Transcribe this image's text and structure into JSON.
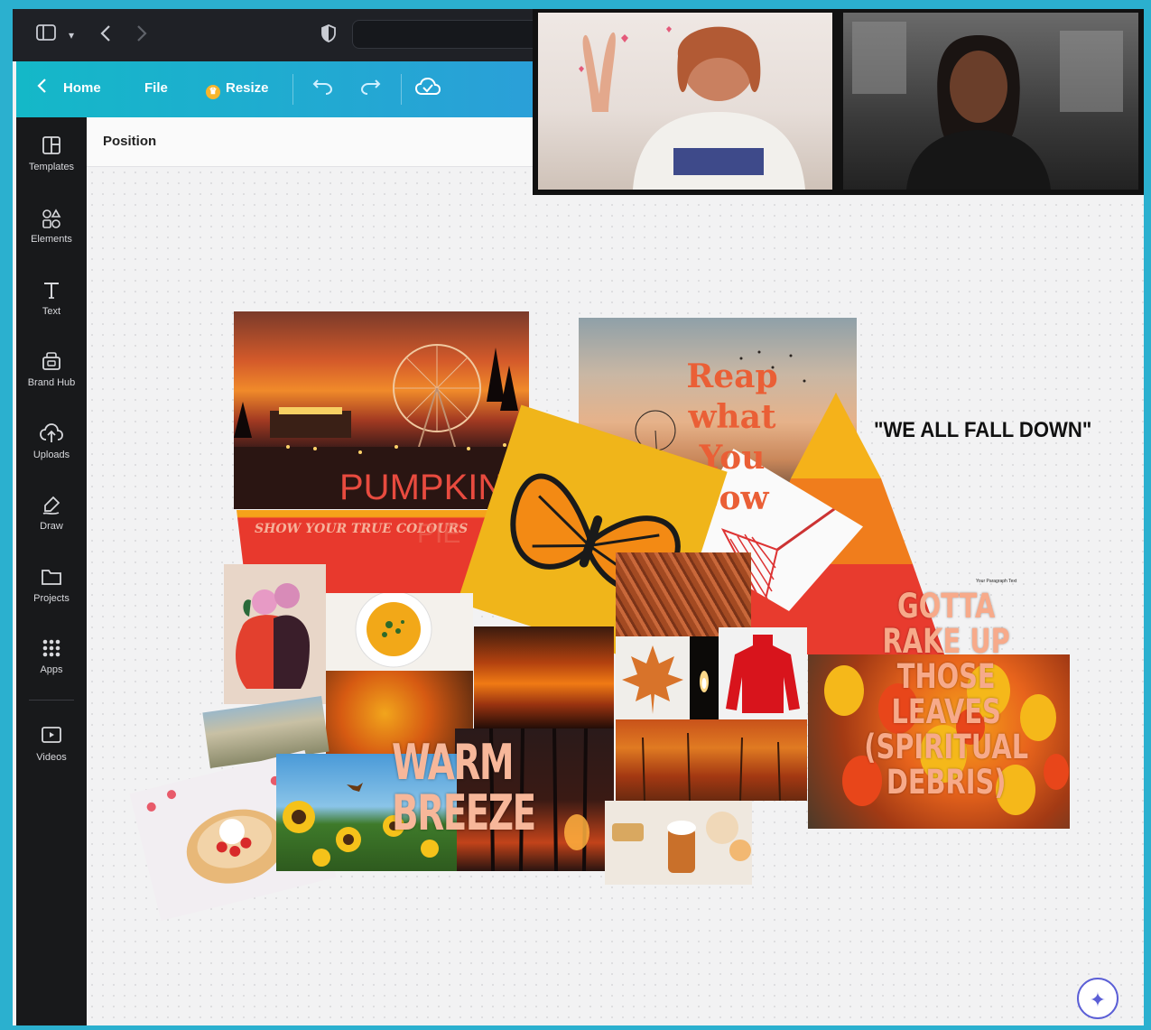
{
  "browser": {
    "sidebar_toggle_icon": "sidebar-icon",
    "back_icon": "chevron-left-icon",
    "forward_icon": "chevron-right-icon",
    "shield_icon": "shield-icon"
  },
  "toolbar": {
    "home_label": "Home",
    "file_label": "File",
    "resize_label": "Resize",
    "undo_icon": "undo-icon",
    "redo_icon": "redo-icon",
    "cloud_icon": "cloud-check-icon"
  },
  "sidebar": {
    "items": [
      {
        "label": "Templates",
        "icon": "templates-icon"
      },
      {
        "label": "Elements",
        "icon": "elements-icon"
      },
      {
        "label": "Text",
        "icon": "text-icon"
      },
      {
        "label": "Brand Hub",
        "icon": "brand-hub-icon"
      },
      {
        "label": "Uploads",
        "icon": "uploads-icon"
      },
      {
        "label": "Draw",
        "icon": "draw-icon"
      },
      {
        "label": "Projects",
        "icon": "projects-icon"
      },
      {
        "label": "Apps",
        "icon": "apps-icon"
      },
      {
        "label": "Videos",
        "icon": "videos-icon"
      }
    ]
  },
  "panel": {
    "position_label": "Position"
  },
  "canvas": {
    "pumpkin_text": "PUMPKIN",
    "pie_text": "PIE",
    "show_colours_text": "SHOW YOUR TRUE COLOURS",
    "reap_lines": [
      "Reap",
      "what",
      "You",
      "Sow"
    ],
    "quote_text": "\"WE ALL FALL DOWN\"",
    "paragraph_text": "Your Paragraph Text",
    "rake_lines": [
      "GOTTA",
      "RAKE UP",
      "THOSE",
      "LEAVES",
      "(SPIRITUAL",
      "DEBRIS)"
    ],
    "warm_lines": [
      "WARM",
      "BREEZE"
    ]
  },
  "colors": {
    "accent_teal": "#14b8c8",
    "accent_purple": "#6b57e6",
    "sidebar_bg": "#18191b",
    "autumn_orange": "#f06a1c",
    "autumn_red": "#e83b2e",
    "autumn_yellow": "#f5b21a"
  },
  "magic_button_icon": "sparkle-icon"
}
